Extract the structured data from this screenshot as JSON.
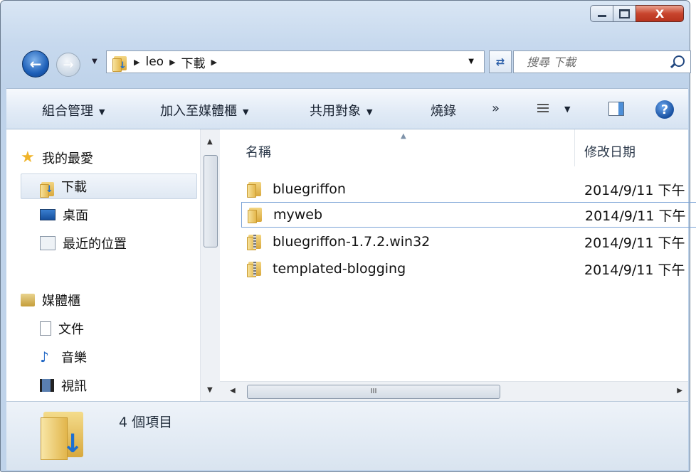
{
  "window": {
    "buttons": {
      "close_label": "X"
    }
  },
  "nav": {
    "breadcrumbs": [
      "leo",
      "下載"
    ],
    "search_placeholder": "搜尋 下載"
  },
  "toolbar": {
    "organize": "組合管理",
    "include_in_library": "加入至媒體櫃",
    "share_with": "共用對象",
    "burn": "燒錄",
    "more": "»"
  },
  "sidebar": {
    "items": [
      {
        "label": "我的最愛",
        "icon": "star-icon"
      },
      {
        "label": "下載",
        "icon": "downloads-folder-icon",
        "selected": true
      },
      {
        "label": "桌面",
        "icon": "desktop-icon"
      },
      {
        "label": "最近的位置",
        "icon": "recent-places-icon"
      },
      {
        "label": "媒體櫃",
        "icon": "libraries-icon"
      },
      {
        "label": "文件",
        "icon": "document-icon"
      },
      {
        "label": "音樂",
        "icon": "music-icon"
      },
      {
        "label": "視訊",
        "icon": "video-icon"
      }
    ]
  },
  "columns": {
    "name": "名稱",
    "date_modified": "修改日期"
  },
  "files": [
    {
      "name": "bluegriffon",
      "date": "2014/9/11 下午",
      "type": "folder"
    },
    {
      "name": "myweb",
      "date": "2014/9/11 下午",
      "type": "folder"
    },
    {
      "name": "bluegriffon-1.7.2.win32",
      "date": "2014/9/11 下午",
      "type": "zip"
    },
    {
      "name": "templated-blogging",
      "date": "2014/9/11 下午",
      "type": "zip"
    }
  ],
  "status": {
    "item_count": "4 個項目"
  },
  "scrollbar": {
    "grip": "III"
  }
}
